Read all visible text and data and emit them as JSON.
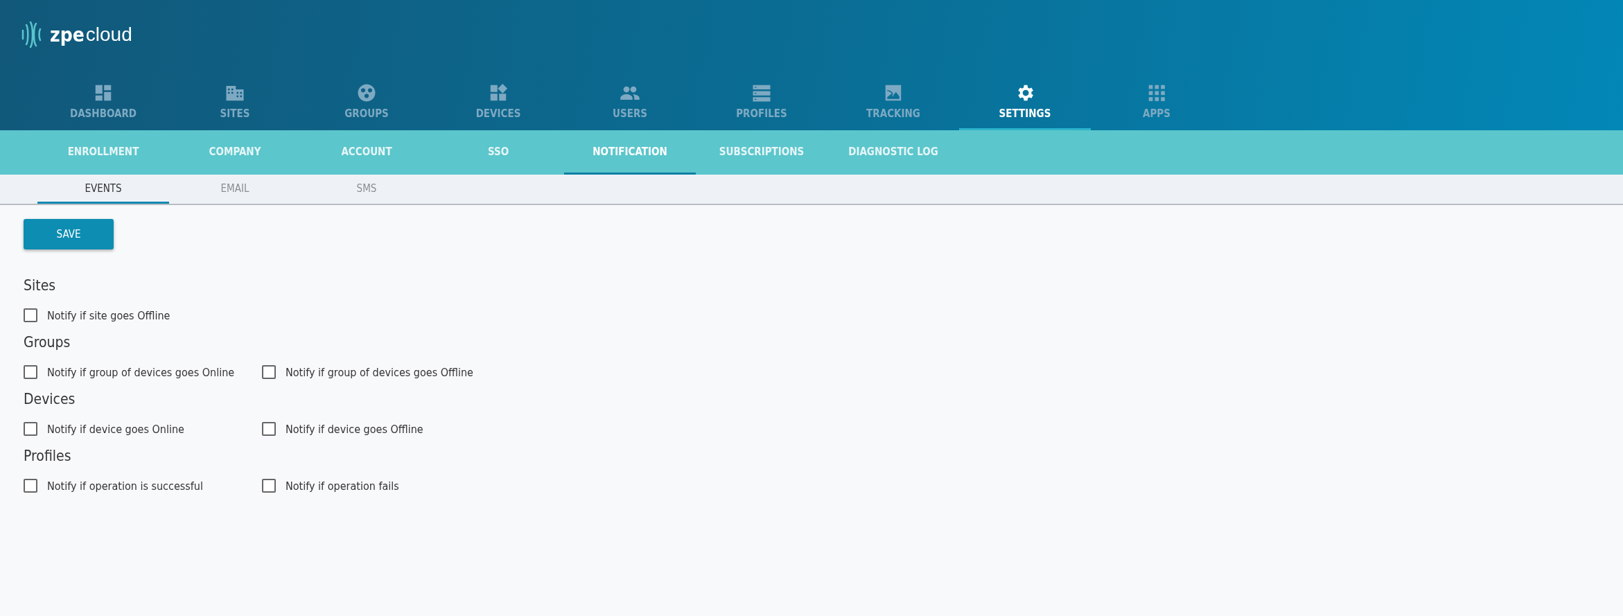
{
  "logo": {
    "brand": "zpe",
    "product": "cloud"
  },
  "main_nav": [
    {
      "label": "DASHBOARD",
      "selected": false
    },
    {
      "label": "SITES",
      "selected": false
    },
    {
      "label": "GROUPS",
      "selected": false
    },
    {
      "label": "DEVICES",
      "selected": false
    },
    {
      "label": "USERS",
      "selected": false
    },
    {
      "label": "PROFILES",
      "selected": false
    },
    {
      "label": "TRACKING",
      "selected": false
    },
    {
      "label": "SETTINGS",
      "selected": true
    },
    {
      "label": "APPS",
      "selected": false
    }
  ],
  "settings_tabs": [
    {
      "label": "ENROLLMENT",
      "selected": false
    },
    {
      "label": "COMPANY",
      "selected": false
    },
    {
      "label": "ACCOUNT",
      "selected": false
    },
    {
      "label": "SSO",
      "selected": false
    },
    {
      "label": "NOTIFICATION",
      "selected": true
    },
    {
      "label": "SUBSCRIPTIONS",
      "selected": false
    },
    {
      "label": "DIAGNOSTIC LOG",
      "selected": false
    }
  ],
  "notification_tabs": [
    {
      "label": "EVENTS",
      "selected": true
    },
    {
      "label": "EMAIL",
      "selected": false
    },
    {
      "label": "SMS",
      "selected": false
    }
  ],
  "save_button": "SAVE",
  "sections": [
    {
      "title": "Sites",
      "options": [
        {
          "label": "Notify if site goes Offline",
          "checked": false
        }
      ]
    },
    {
      "title": "Groups",
      "options": [
        {
          "label": "Notify if group of devices goes Online",
          "checked": false
        },
        {
          "label": "Notify if group of devices goes Offline",
          "checked": false
        }
      ]
    },
    {
      "title": "Devices",
      "options": [
        {
          "label": "Notify if device goes Online",
          "checked": false
        },
        {
          "label": "Notify if device goes Offline",
          "checked": false
        }
      ]
    },
    {
      "title": "Profiles",
      "options": [
        {
          "label": "Notify if operation is successful",
          "checked": false
        },
        {
          "label": "Notify if operation fails",
          "checked": false
        }
      ]
    }
  ]
}
